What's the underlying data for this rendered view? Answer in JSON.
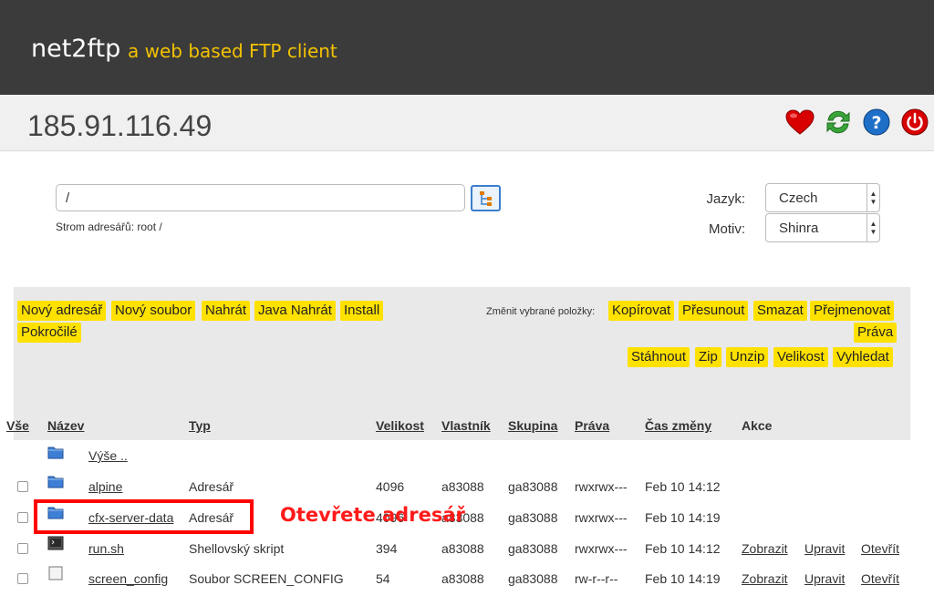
{
  "header": {
    "brand": "net2ftp",
    "tagline": "a web based FTP client"
  },
  "host": "185.91.116.49",
  "top_icons": [
    {
      "name": "bookmark-heart-icon",
      "color": "#d80000"
    },
    {
      "name": "refresh-icon",
      "color": "#3aa43a"
    },
    {
      "name": "help-icon",
      "color": "#1e6fc8"
    },
    {
      "name": "logout-icon",
      "color": "#d80000"
    }
  ],
  "path": {
    "value": "/",
    "tree_label": "Strom adresářů: root /"
  },
  "settings": {
    "language_label": "Jazyk:",
    "language_value": "Czech",
    "theme_label": "Motiv:",
    "theme_value": "Shinra"
  },
  "actions": {
    "left": [
      "Nový adresář",
      "Nový soubor",
      "Nahrát",
      "Java Nahrát",
      "Install",
      "Pokročilé"
    ],
    "change_label": "Změnit vybrané položky:",
    "right_row1": [
      "Kopírovat",
      "Přesunout",
      "Smazat",
      "Přejmenovat"
    ],
    "right_row2": [
      "Práva"
    ],
    "right_row3": [
      "Stáhnout",
      "Zip",
      "Unzip",
      "Velikost",
      "Vyhledat"
    ]
  },
  "columns": [
    "Vše",
    "Název",
    "Typ",
    "Velikost",
    "Vlastník",
    "Skupina",
    "Práva",
    "Čas změny",
    "Akce"
  ],
  "up_label": "Výše ..",
  "rows": [
    {
      "name": "alpine",
      "type": "Adresář",
      "size": "4096",
      "owner": "a83088",
      "group": "ga83088",
      "perms": "rwxrwx---",
      "mtime": "Feb 10 14:12",
      "icon": "folder-icon",
      "actions": []
    },
    {
      "name": "cfx-server-data",
      "type": "Adresář",
      "size": "4096",
      "owner": "a83088",
      "group": "ga83088",
      "perms": "rwxrwx---",
      "mtime": "Feb 10 14:19",
      "icon": "folder-icon",
      "actions": []
    },
    {
      "name": "run.sh",
      "type": "Shellovský skript",
      "size": "394",
      "owner": "a83088",
      "group": "ga83088",
      "perms": "rwxrwx---",
      "mtime": "Feb 10 14:12",
      "icon": "terminal-icon",
      "actions": [
        "Zobrazit",
        "Upravit",
        "Otevřít"
      ]
    },
    {
      "name": "screen_config",
      "type": "Soubor SCREEN_CONFIG",
      "size": "54",
      "owner": "a83088",
      "group": "ga83088",
      "perms": "rw-r--r--",
      "mtime": "Feb 10 14:19",
      "icon": "file-icon",
      "actions": [
        "Zobrazit",
        "Upravit",
        "Otevřít"
      ]
    }
  ],
  "annotation": "Otevřete adresář",
  "colors": {
    "button_yellow": "#ffe100",
    "annotation_red": "#ff0000",
    "header_dark": "#3b3b3b",
    "tagline_yellow": "#f2c200"
  }
}
